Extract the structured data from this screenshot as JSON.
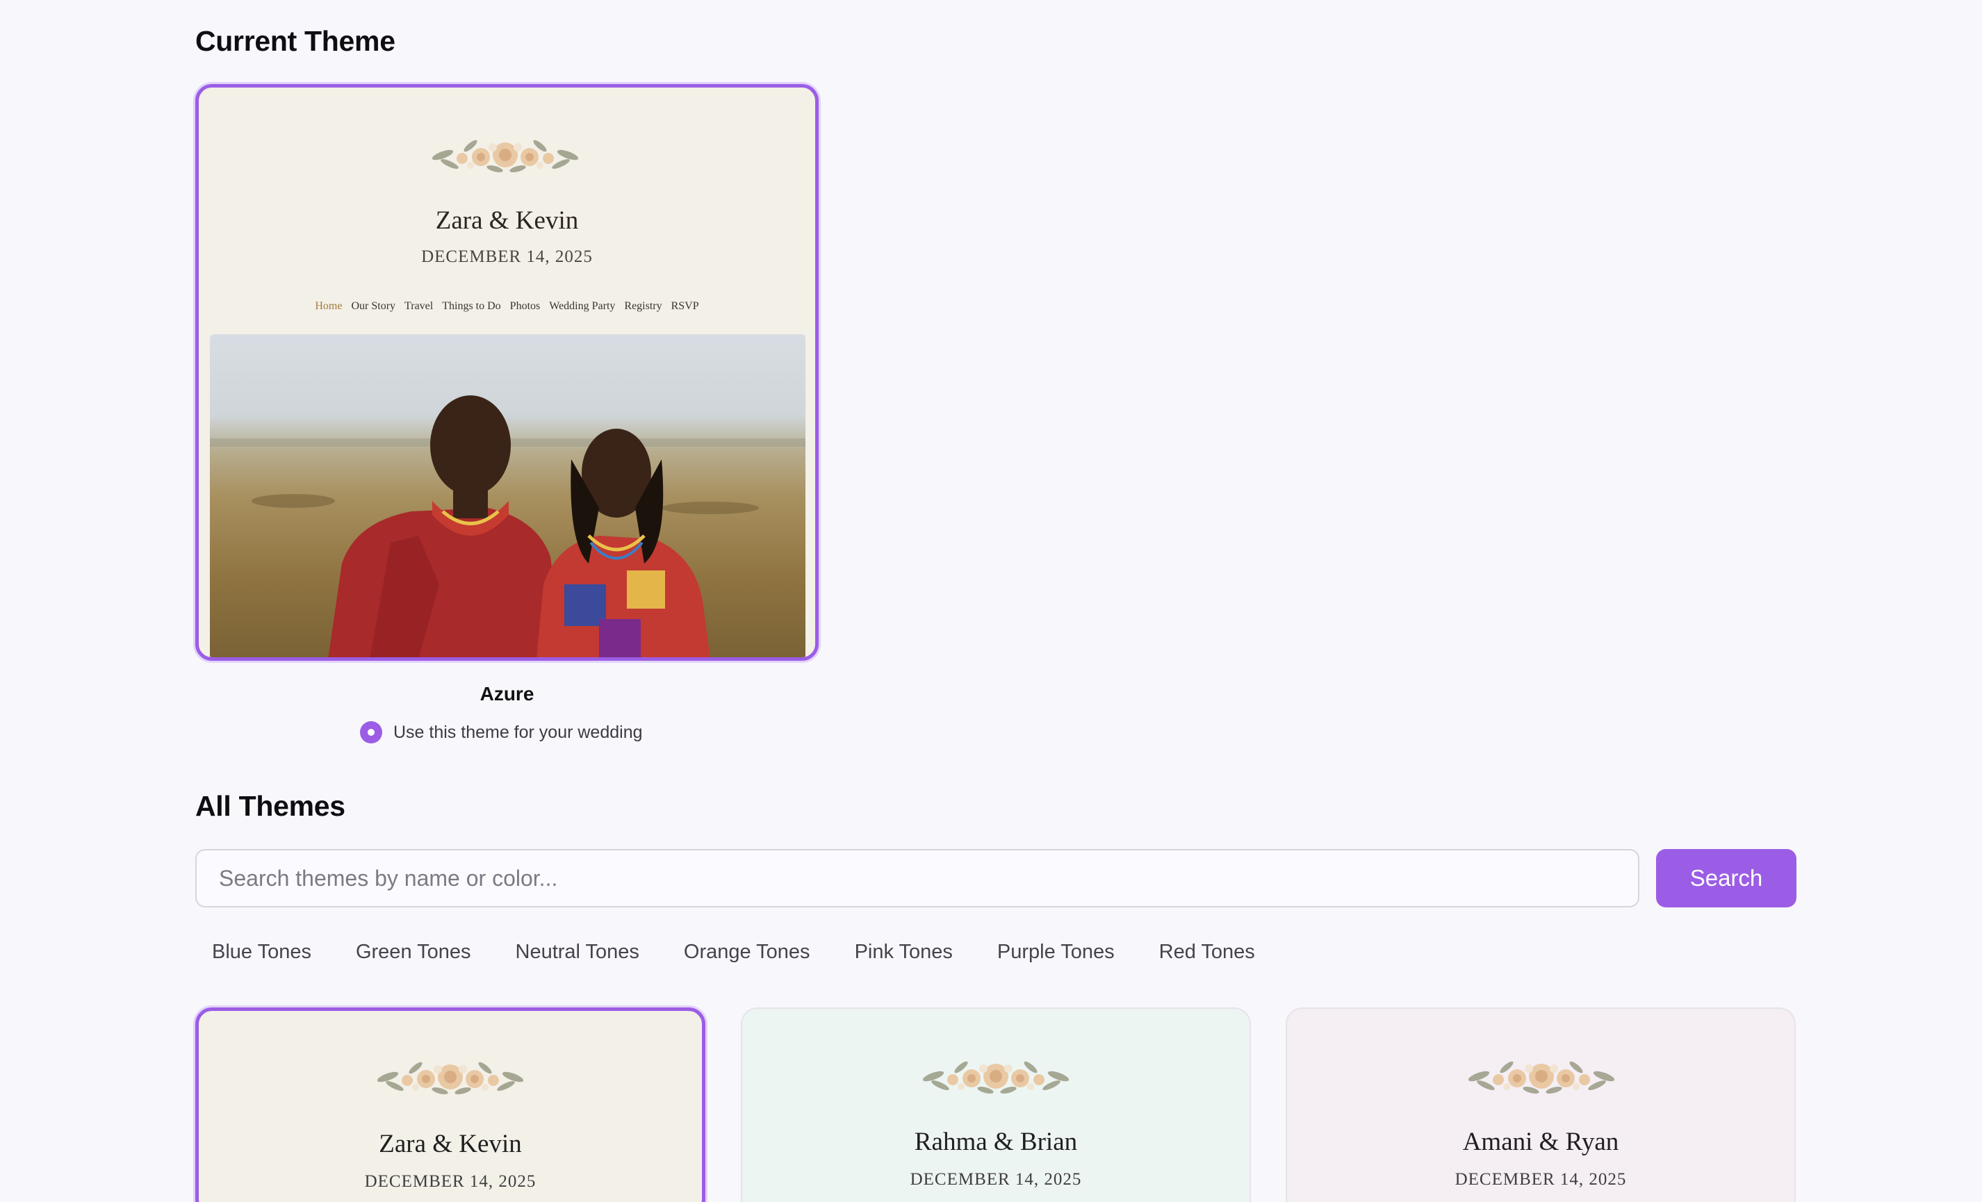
{
  "current_section": {
    "title": "Current Theme",
    "preview": {
      "names": "Zara & Kevin",
      "date": "DECEMBER 14, 2025",
      "nav": [
        "Home",
        "Our Story",
        "Travel",
        "Things to Do",
        "Photos",
        "Wedding Party",
        "Registry",
        "RSVP"
      ],
      "nav_active": "Home"
    },
    "theme_name": "Azure",
    "use_theme_label": "Use this theme for your wedding"
  },
  "all_section": {
    "title": "All Themes",
    "search_placeholder": "Search themes by name or color...",
    "search_button": "Search",
    "filters": [
      "Blue Tones",
      "Green Tones",
      "Neutral Tones",
      "Orange Tones",
      "Pink Tones",
      "Purple Tones",
      "Red Tones"
    ],
    "themes": [
      {
        "names": "Zara & Kevin",
        "date": "DECEMBER 14, 2025",
        "bg": "#f3f0e8",
        "selected": true
      },
      {
        "names": "Rahma & Brian",
        "date": "DECEMBER 14, 2025",
        "bg": "#edf5f2",
        "selected": false
      },
      {
        "names": "Amani & Ryan",
        "date": "DECEMBER 14, 2025",
        "bg": "#f5eef3",
        "selected": false
      }
    ]
  },
  "colors": {
    "accent": "#9b5de5",
    "page_bg": "#f8f7fc"
  }
}
